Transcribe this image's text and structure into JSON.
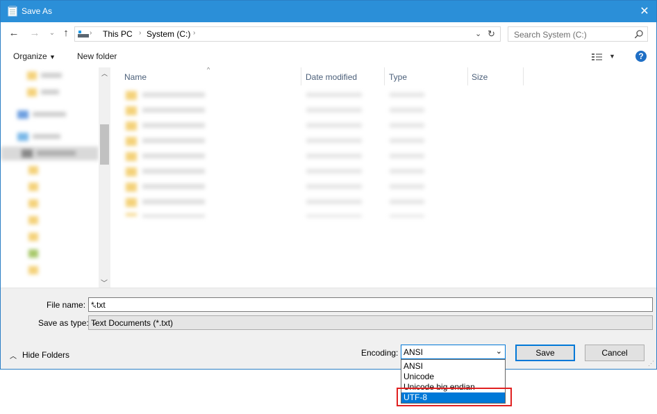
{
  "window": {
    "title": "Save As",
    "close": "✕"
  },
  "address": {
    "path": [
      "This PC",
      "System (C:)"
    ],
    "search_placeholder": "Search System (C:)"
  },
  "toolbar": {
    "organize": "Organize",
    "new_folder": "New folder",
    "help": "?"
  },
  "columns": [
    "Name",
    "Date modified",
    "Type",
    "Size"
  ],
  "form": {
    "file_name_label": "File name:",
    "file_name_value": "*.txt",
    "save_type_label": "Save as type:",
    "save_type_value": "Text Documents (*.txt)",
    "hide_folders": "Hide Folders",
    "encoding_label": "Encoding:",
    "encoding_value": "ANSI",
    "save": "Save",
    "cancel": "Cancel"
  },
  "encoding_options": [
    "ANSI",
    "Unicode",
    "Unicode big endian",
    "UTF-8"
  ],
  "encoding_highlighted": "UTF-8",
  "colors": {
    "titlebar": "#2b8fd8",
    "accent": "#0078d7",
    "annotation": "#e02020"
  }
}
